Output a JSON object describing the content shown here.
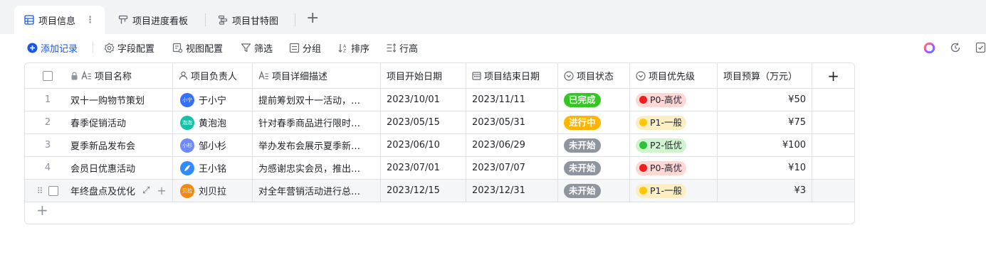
{
  "tabs": [
    {
      "label": "项目信息",
      "icon": "grid-table-icon",
      "active": true
    },
    {
      "label": "项目进度看板",
      "icon": "kanban-icon",
      "active": false
    },
    {
      "label": "项目甘特图",
      "icon": "gantt-icon",
      "active": false
    }
  ],
  "tab_more": "⋮",
  "tab_add": "+",
  "toolbar": {
    "add_record": "添加记录",
    "field_config": "字段配置",
    "view_config": "视图配置",
    "filter": "筛选",
    "group": "分组",
    "sort": "排序",
    "row_height": "行高"
  },
  "columns": {
    "name": "项目名称",
    "owner": "项目负责人",
    "desc": "项目详细描述",
    "start": "项目开始日期",
    "end": "项目结束日期",
    "status": "项目状态",
    "priority": "项目优先级",
    "budget": "项目预算（万元）",
    "add": "+"
  },
  "rows": [
    {
      "idx": "1",
      "name": "双十一购物节策划",
      "owner": "于小宁",
      "avatar": "小宁",
      "avatar_color": "#3370ff",
      "desc": "提前筹划双十一活动，…",
      "start": "2023/10/01",
      "end": "2023/11/11",
      "status": "已完成",
      "status_color": "#34c724",
      "priority": "P0-高优",
      "prio_bg": "#ffd7d5",
      "prio_dot": "#f01d1d",
      "budget": "¥50"
    },
    {
      "idx": "2",
      "name": "春季促销活动",
      "owner": "黄泡泡",
      "avatar": "泡泡",
      "avatar_color": "#14c0a8",
      "desc": "针对春季商品进行限时…",
      "start": "2023/05/15",
      "end": "2023/05/31",
      "status": "进行中",
      "status_color": "#ffb400",
      "priority": "P1-一般",
      "prio_bg": "#fbeec2",
      "prio_dot": "#ffc60a",
      "budget": "¥75"
    },
    {
      "idx": "3",
      "name": "夏季新品发布会",
      "owner": "邹小杉",
      "avatar": "小杉",
      "avatar_color": "#6f89ff",
      "desc": "举办发布会展示夏季新…",
      "start": "2023/06/10",
      "end": "2023/06/29",
      "status": "未开始",
      "status_color": "#8f959e",
      "priority": "P2-低优",
      "prio_bg": "#d0f5ce",
      "prio_dot": "#2ec23a",
      "budget": "¥100"
    },
    {
      "idx": "4",
      "name": "会员日优惠活动",
      "owner": "王小铭",
      "avatar": "",
      "avatar_color": "#2f8cff",
      "desc": "为感谢忠实会员，推出…",
      "start": "2023/07/01",
      "end": "2023/07/07",
      "status": "未开始",
      "status_color": "#8f959e",
      "priority": "P0-高优",
      "prio_bg": "#ffd7d5",
      "prio_dot": "#f01d1d",
      "budget": "¥10"
    },
    {
      "idx": "",
      "name": "年终盘点及优化",
      "owner": "刘贝拉",
      "avatar": "贝拉",
      "avatar_color": "#ed8a18",
      "desc": "对全年营销活动进行总…",
      "start": "2023/12/15",
      "end": "2023/12/31",
      "status": "未开始",
      "status_color": "#8f959e",
      "priority": "P1-一般",
      "prio_bg": "#fbeec2",
      "prio_dot": "#ffc60a",
      "budget": "¥3"
    }
  ],
  "add_row": "+"
}
